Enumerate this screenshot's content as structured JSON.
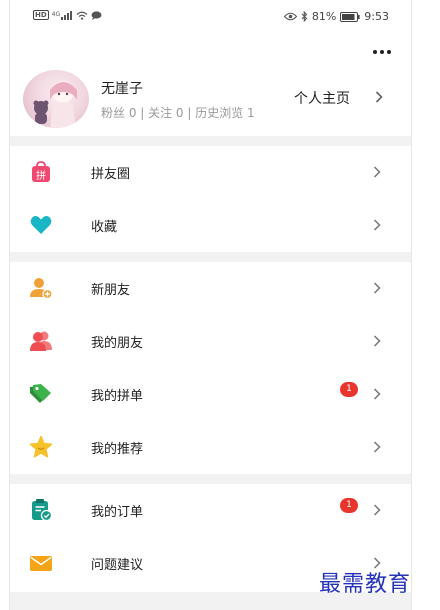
{
  "status_bar": {
    "network_badge": "HD",
    "signal_label": "4G",
    "battery_percent": "81%",
    "time": "9:53"
  },
  "header": {
    "more_icon": "more-horizontal-icon"
  },
  "profile": {
    "name": "无崖子",
    "stats": "粉丝 0 | 关注 0 | 历史浏览 1",
    "homepage_label": "个人主页"
  },
  "menu": {
    "groups": [
      {
        "items": [
          {
            "label": "拼友圈",
            "icon": "pin-bag-icon",
            "icon_text": "拼",
            "color": "#f1486f"
          },
          {
            "label": "收藏",
            "icon": "heart-icon",
            "color": "#19b6c8"
          }
        ]
      },
      {
        "items": [
          {
            "label": "新朋友",
            "icon": "add-friend-icon",
            "color": "#f0a23a"
          },
          {
            "label": "我的朋友",
            "icon": "friends-icon",
            "color": "#ee4e52"
          },
          {
            "label": "我的拼单",
            "icon": "tag-icon",
            "color": "#3bb24a",
            "badge": "1"
          },
          {
            "label": "我的推荐",
            "icon": "star-icon",
            "color": "#f6c22c"
          }
        ]
      },
      {
        "items": [
          {
            "label": "我的订单",
            "icon": "order-clipboard-icon",
            "color": "#169b8a",
            "badge": "1"
          },
          {
            "label": "问题建议",
            "icon": "mail-icon",
            "color": "#f3a417"
          }
        ]
      }
    ]
  },
  "watermark": "最需教育"
}
